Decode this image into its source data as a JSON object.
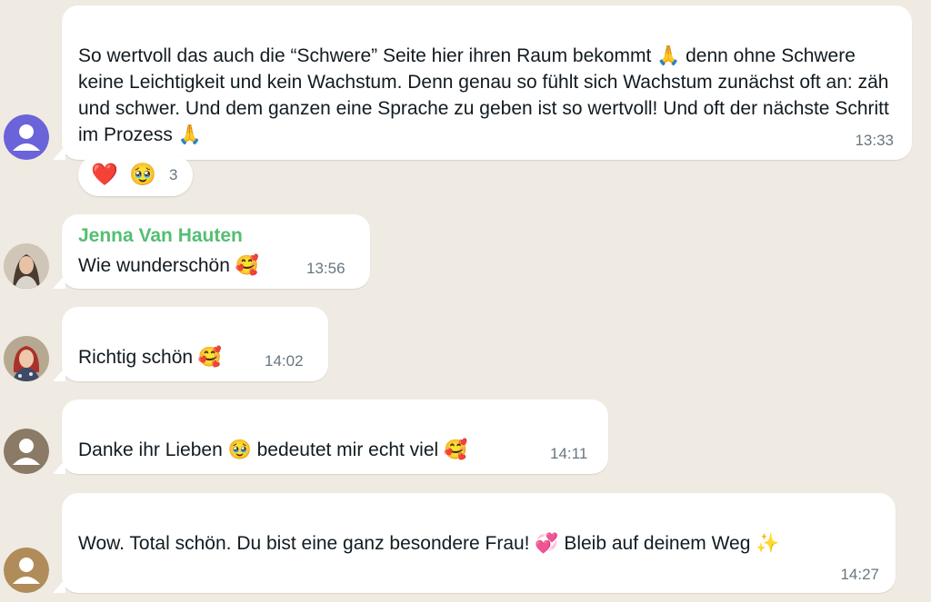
{
  "messages": [
    {
      "text": "So wertvoll das auch die “Schwere” Seite hier ihren Raum bekommt 🙏 denn ohne Schwere keine Leichtigkeit und kein Wachstum. Denn genau so fühlt sich Wachstum zunächst oft an: zäh und schwer. Und dem ganzen eine Sprache zu geben ist so wertvoll! Und oft der nächste Schritt im Prozess 🙏",
      "time": "13:33",
      "avatar": "default-avatar-purple",
      "avatar_color": "#6a63d9",
      "reactions": {
        "emoji1": "❤️",
        "emoji2": "🥹",
        "count": "3"
      }
    },
    {
      "sender": "Jenna Van Hauten",
      "sender_color": "#53bf72",
      "text": "Wie wunderschön 🥰",
      "time": "13:56",
      "avatar": "photo-avatar-woman"
    },
    {
      "text": "Richtig schön 🥰",
      "time": "14:02",
      "avatar": "photo-avatar-woman-red-hair"
    },
    {
      "text": "Danke ihr Lieben 🥹 bedeutet mir echt viel 🥰",
      "time": "14:11",
      "avatar": "default-avatar-brown",
      "avatar_color": "#8a7a66"
    },
    {
      "text": "Wow. Total schön. Du bist eine ganz besondere Frau! 💞 Bleib auf deinem Weg ✨",
      "time": "14:27",
      "avatar": "default-avatar-tan",
      "avatar_color": "#b08c5a"
    }
  ],
  "background_color": "#efeae2"
}
